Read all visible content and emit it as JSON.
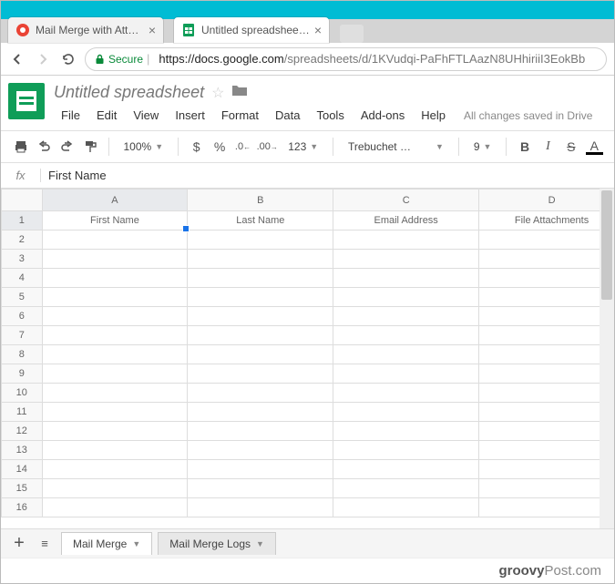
{
  "browser": {
    "tabs": [
      {
        "title": "Mail Merge with Attachm",
        "active": false
      },
      {
        "title": "Untitled spreadsheet - G",
        "active": true
      }
    ],
    "secure_label": "Secure",
    "url_host": "https://docs.google.com",
    "url_rest": "/spreadsheets/d/1KVudqi-PaFhFTLAazN8UHhiriiI3EokBb"
  },
  "doc": {
    "title": "Untitled spreadsheet",
    "menus": [
      "File",
      "Edit",
      "View",
      "Insert",
      "Format",
      "Data",
      "Tools",
      "Add-ons",
      "Help"
    ],
    "saved_msg": "All changes saved in Drive"
  },
  "toolbar": {
    "zoom": "100%",
    "currency": "$",
    "percent": "%",
    "dec_dec": ".0",
    "dec_inc": ".00",
    "fmt": "123",
    "font": "Trebuchet …",
    "size": "9",
    "bold": "B",
    "italic": "I",
    "strike": "S",
    "textcolor": "A"
  },
  "fx": {
    "label": "fx",
    "content": "First Name"
  },
  "grid": {
    "cols": [
      "A",
      "B",
      "C",
      "D"
    ],
    "row_count": 16,
    "headers": [
      "First Name",
      "Last Name",
      "Email Address",
      "File Attachments"
    ]
  },
  "sheets": {
    "tabs": [
      {
        "name": "Mail Merge",
        "active": true
      },
      {
        "name": "Mail Merge Logs",
        "active": false
      }
    ]
  },
  "footer": {
    "brand_bold": "groovy",
    "brand_rest": "Post.com"
  }
}
